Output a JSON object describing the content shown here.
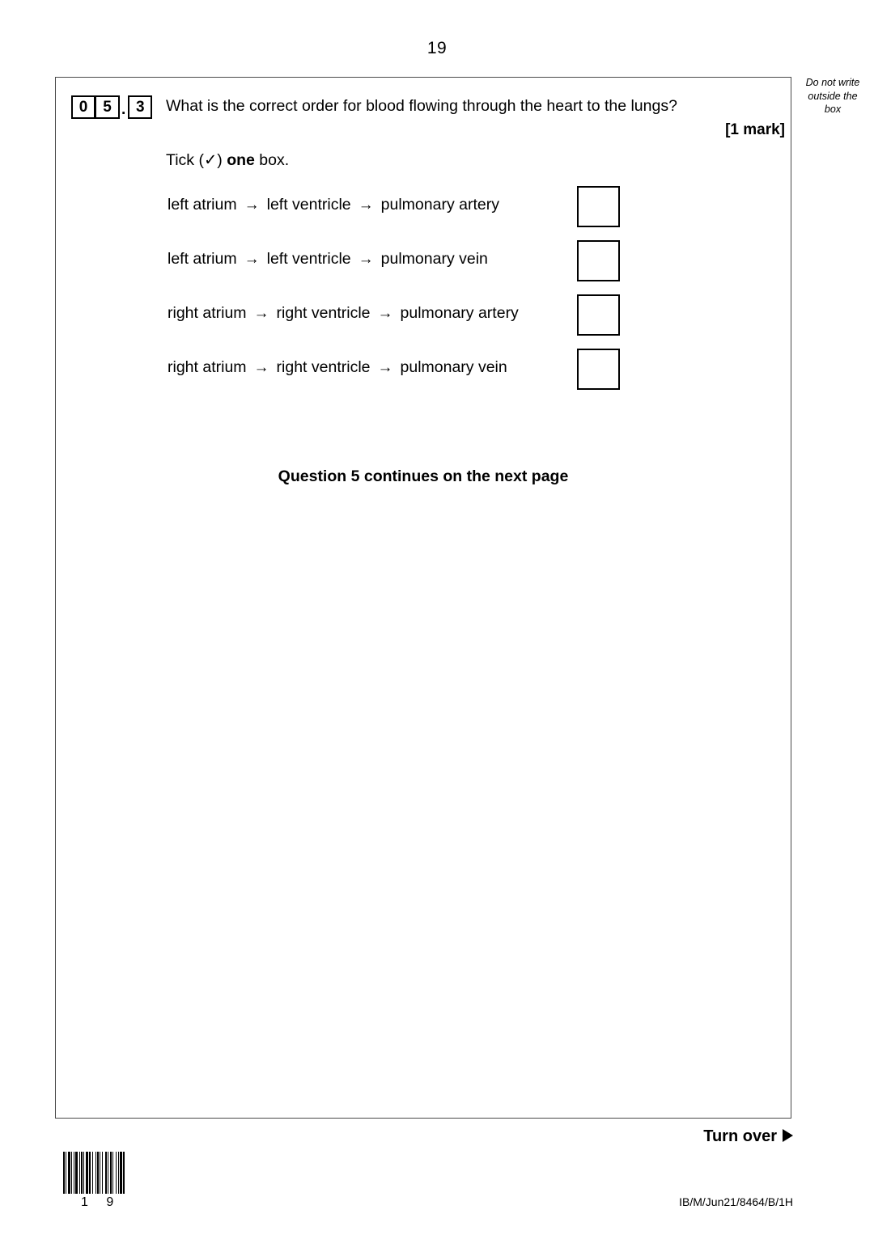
{
  "page": {
    "number": "19",
    "margin_note": "Do not write outside the box",
    "margin_note_lines": [
      "Do not write",
      "outside the",
      "box"
    ],
    "footer_code": "IB/M/Jun21/8464/B/1H",
    "turn_over_label": "Turn over",
    "barcode_label": "1 9"
  },
  "question": {
    "number_digits": [
      "0",
      "5",
      "3"
    ],
    "number_separator": ".",
    "stem": "What is the correct order for blood flowing through the heart to the lungs?",
    "marks": "[1 mark]",
    "instruction_prefix": "Tick (",
    "instruction_tick": "✓",
    "instruction_mid": ") ",
    "instruction_bold": "one",
    "instruction_suffix": " box.",
    "options": [
      {
        "part1": "left atrium",
        "arrow1": "→",
        "part2": "left ventricle",
        "arrow2": "→",
        "part3": "pulmonary artery"
      },
      {
        "part1": "left atrium",
        "arrow1": "→",
        "part2": "left ventricle",
        "arrow2": "→",
        "part3": "pulmonary vein"
      },
      {
        "part1": "right atrium",
        "arrow1": "→",
        "part2": "right ventricle",
        "arrow2": "→",
        "part3": "pulmonary artery"
      },
      {
        "part1": "right atrium",
        "arrow1": "→",
        "part2": "right ventricle",
        "arrow2": "→",
        "part3": "pulmonary vein"
      }
    ],
    "continues_notice": "Question 5 continues on the next page"
  }
}
